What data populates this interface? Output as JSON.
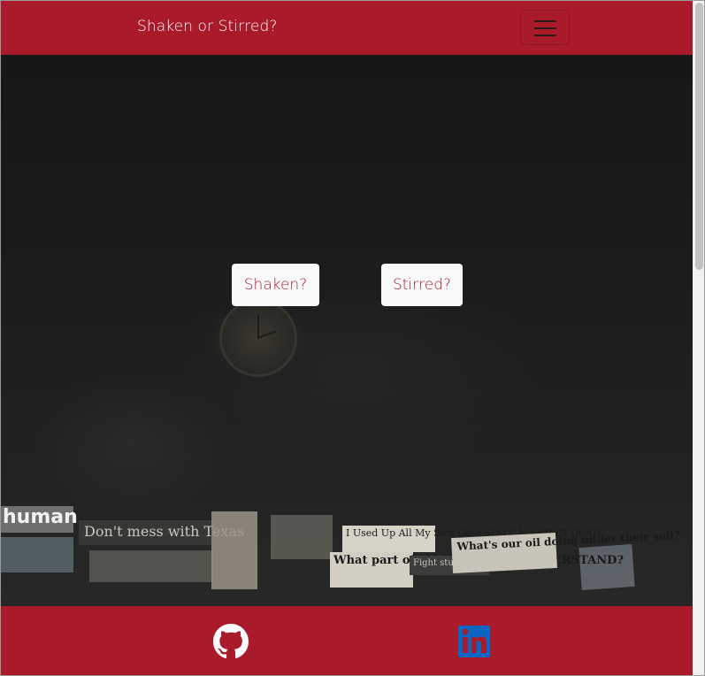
{
  "navbar": {
    "brand": "Shaken or Stirred?",
    "toggler_icon": "hamburger-menu-icon"
  },
  "hero": {
    "shaken_label": "Shaken?",
    "stirred_label": "Stirred?",
    "background": {
      "stickers": {
        "s1": "human",
        "s2": "Don't mess with Texas",
        "s4": "I Used Up All My Sick Days SO I CALLED IN DEAD",
        "s5": "What part of NO DON'T YOU UNDERSTAND?",
        "s6": "What's our oil doing under their soil?",
        "s11": "Fight stupidization."
      }
    }
  },
  "footer": {
    "github_icon": "github-icon",
    "linkedin_icon": "linkedin-icon"
  },
  "colors": {
    "brand_red": "#a91b2b",
    "button_bg": "#f8f9fa",
    "linkedin_blue": "#0a66c2"
  }
}
